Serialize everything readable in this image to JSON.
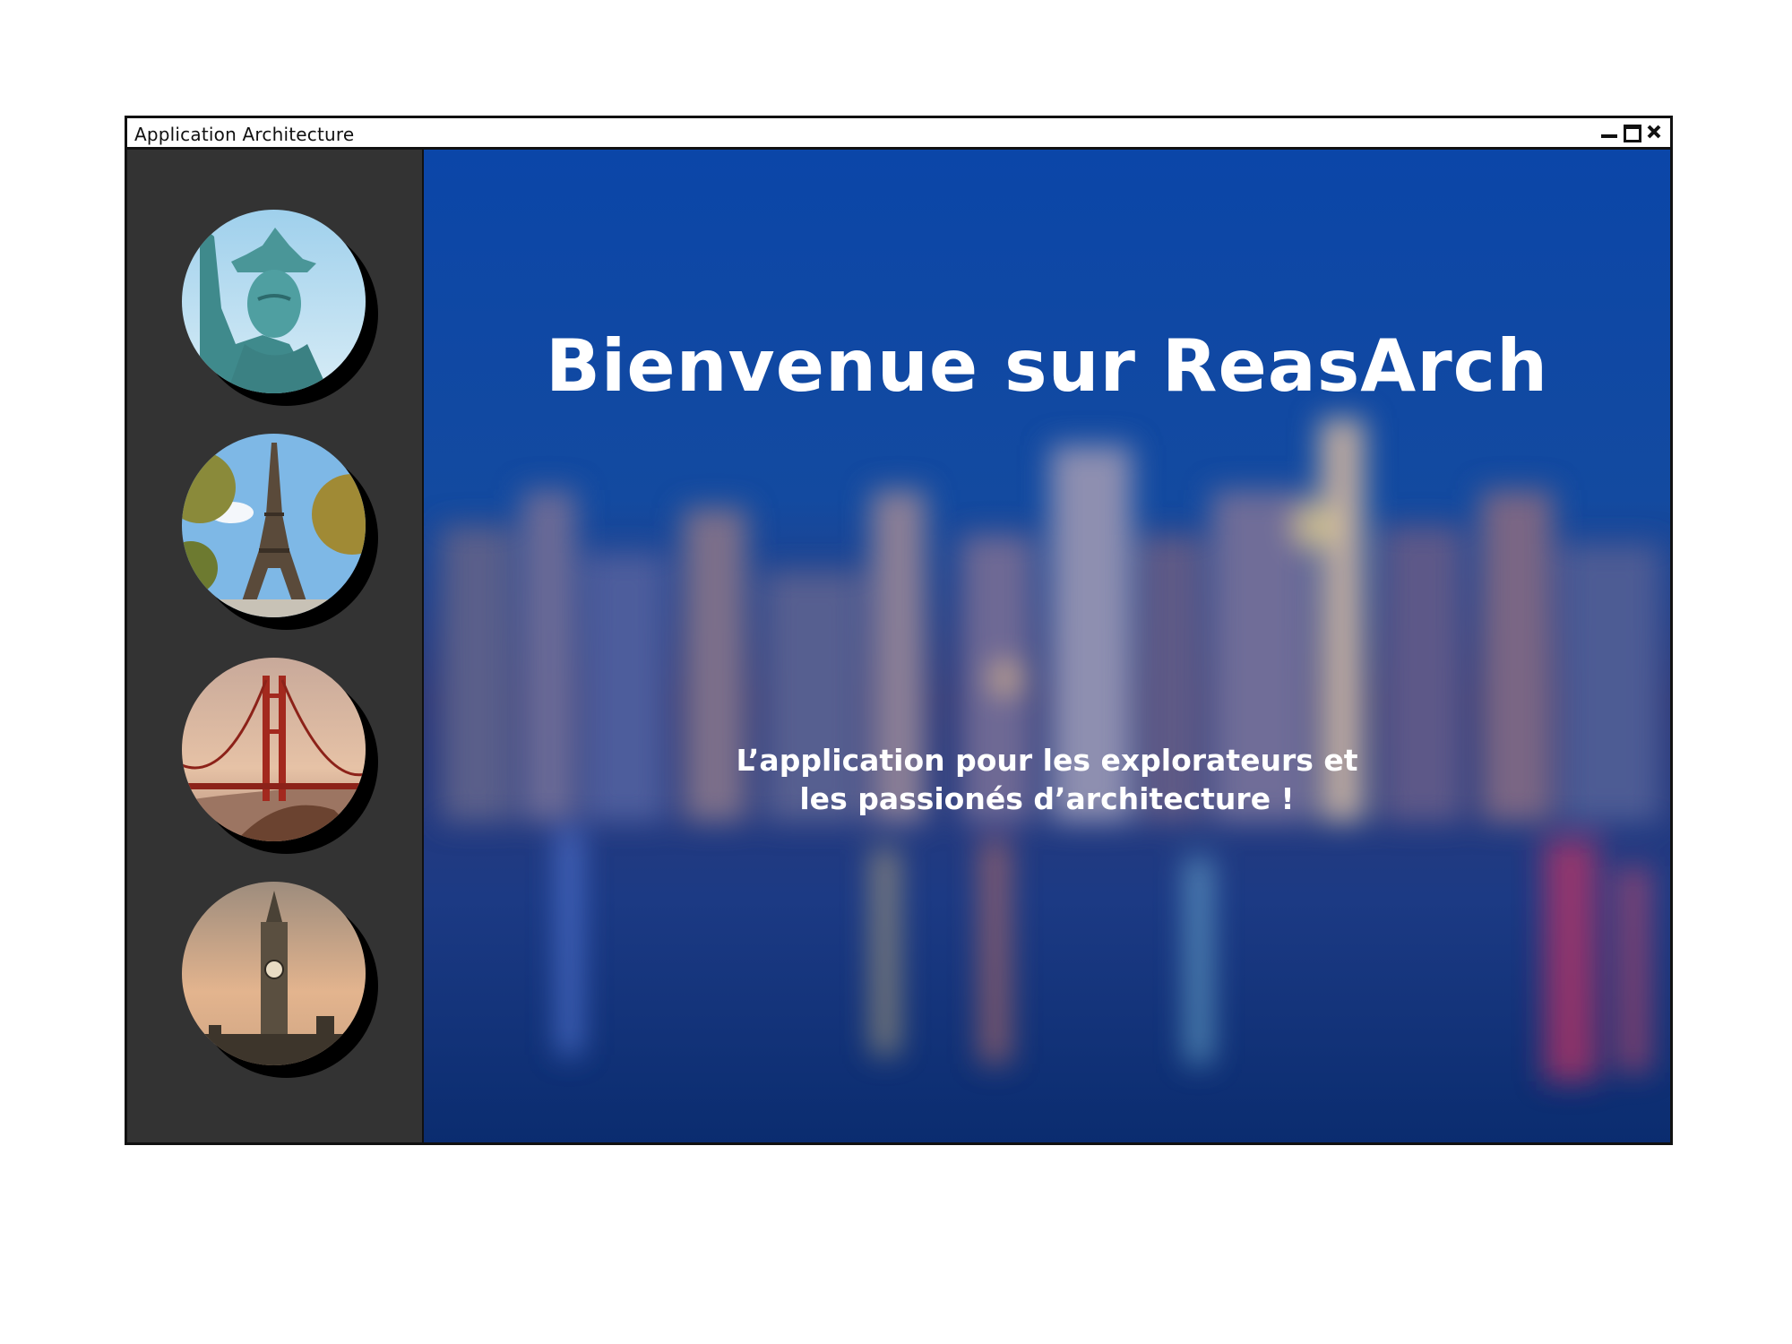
{
  "window": {
    "title": "Application Architecture"
  },
  "controls": {
    "minimize": "minimize-icon",
    "maximize": "maximize-icon",
    "close": "close-icon"
  },
  "sidebar": {
    "items": [
      {
        "icon": "statue-of-liberty-image"
      },
      {
        "icon": "eiffel-tower-image"
      },
      {
        "icon": "golden-gate-bridge-image"
      },
      {
        "icon": "big-ben-image"
      }
    ]
  },
  "hero": {
    "title": "Bienvenue sur ReasArch",
    "subtitle_line1": "L’application pour les explorateurs et",
    "subtitle_line2": "les passionés d’architecture !"
  },
  "colors": {
    "sidebar": "#333333",
    "hero_blue": "#0a3b8f",
    "text": "#ffffff"
  }
}
